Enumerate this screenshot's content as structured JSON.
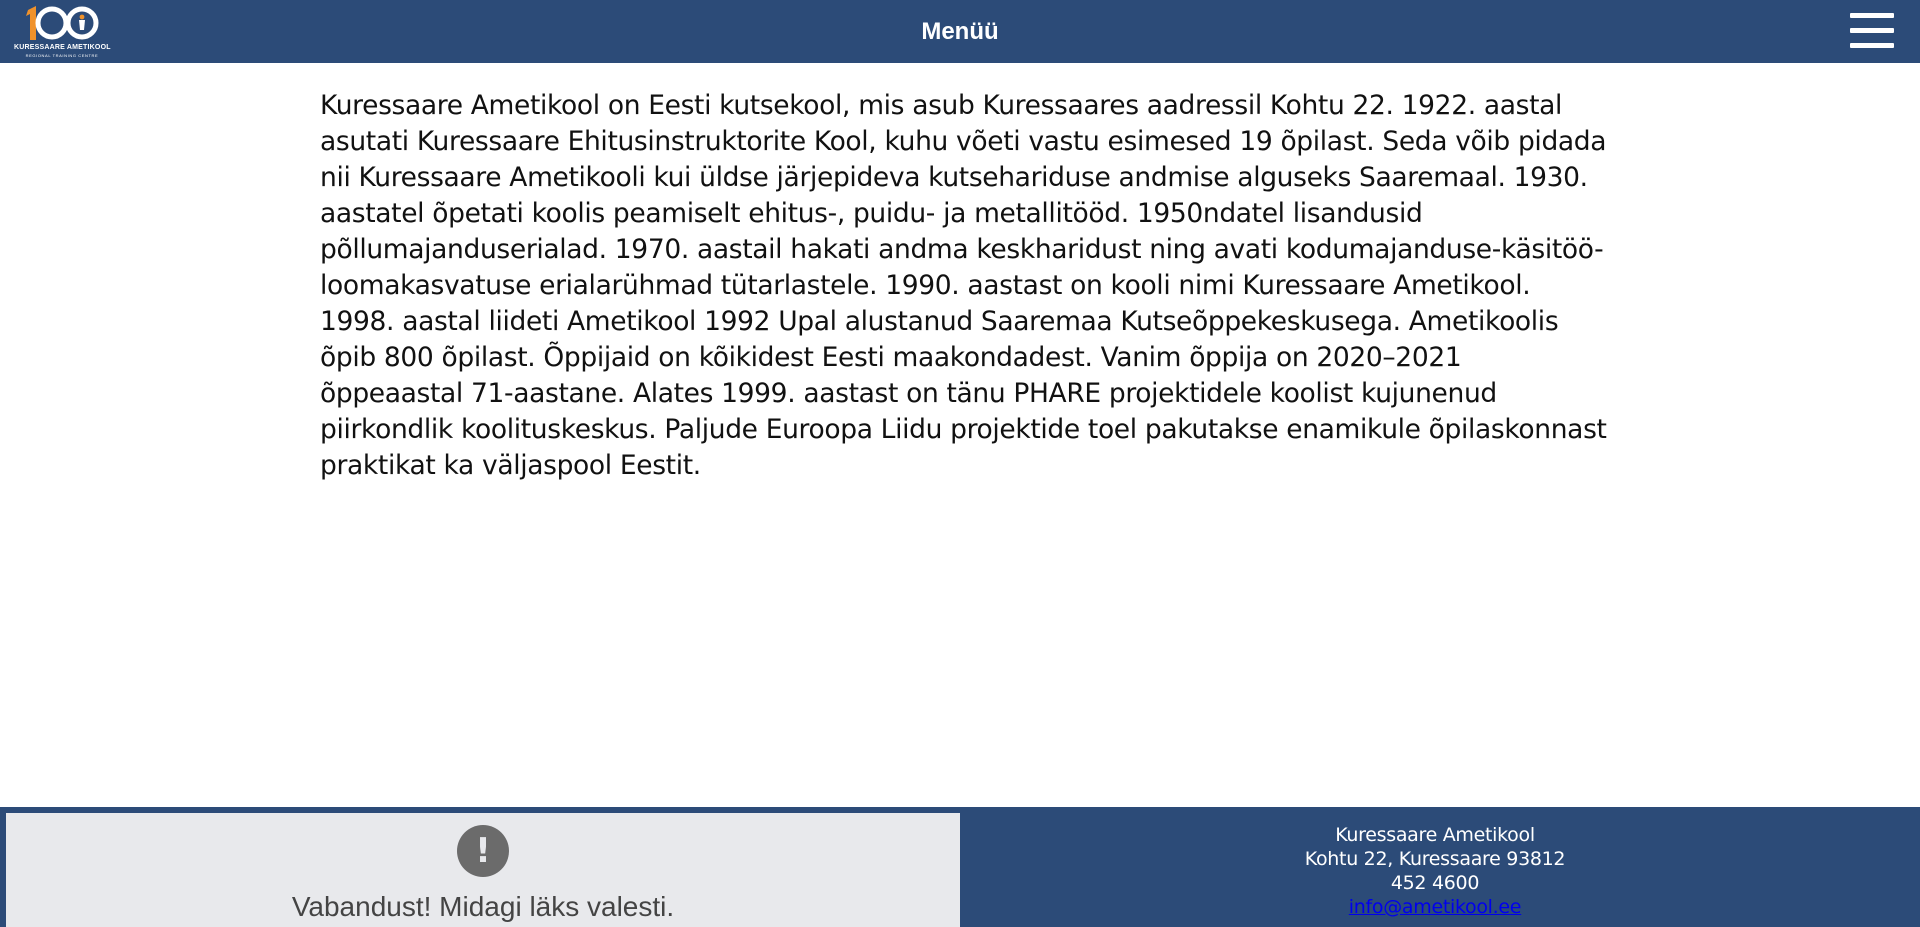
{
  "header": {
    "logo": {
      "number": "100",
      "name": "KURESSAARE AMETIKOOL",
      "subtitle": "REGIONAL TRAINING CENTRE"
    },
    "menu_label": "Menüü",
    "menu_icon": "hamburger-icon"
  },
  "main": {
    "text": "Kuressaare Ametikool on Eesti kutsekool, mis asub Kuressaares aadressil Kohtu 22. 1922. aastal asutati Kuressaare Ehitusinstruktorite Kool, kuhu võeti vastu esimesed 19 õpilast. Seda võib pidada nii Kuressaare Ametikooli kui üldse järjepideva kutsehariduse andmise alguseks Saaremaal. 1930. aastatel õpetati koolis peamiselt ehitus-, puidu- ja metallitööd. 1950ndatel lisandusid põllumajanduserialad. 1970. aastail hakati andma keskharidust ning avati kodumajanduse-käsitöö-loomakasvatuse erialarühmad tütarlastele. 1990. aastast on kooli nimi Kuressaare Ametikool. 1998. aastal liideti Ametikool 1992 Upal alustanud Saaremaa Kutseõppekeskusega. Ametikoolis õpib 800 õpilast. Õppijaid on kõikidest Eesti maakondadest. Vanim õppija on 2020–2021 õppeaastal 71-aastane. Alates 1999. aastast on tänu PHARE projektidele koolist kujunenud piirkondlik koolituskeskus. Paljude Euroopa Liidu projektide toel pakutakse enamikule õpilaskonnast praktikat ka väljaspool Eestit."
  },
  "footer": {
    "error": {
      "icon": "exclamation-icon",
      "symbol": "!",
      "message": "Vabandust! Midagi läks valesti."
    },
    "contact": {
      "name": "Kuressaare Ametikool",
      "address": "Kohtu 22, Kuressaare 93812",
      "phone": "452 4600",
      "email": "info@ametikool.ee"
    }
  },
  "colors": {
    "header_bg": "#2c4b78",
    "footer_bg": "#2c4b78",
    "error_bg": "#e8e9ec",
    "logo_accent": "#f0922b"
  }
}
